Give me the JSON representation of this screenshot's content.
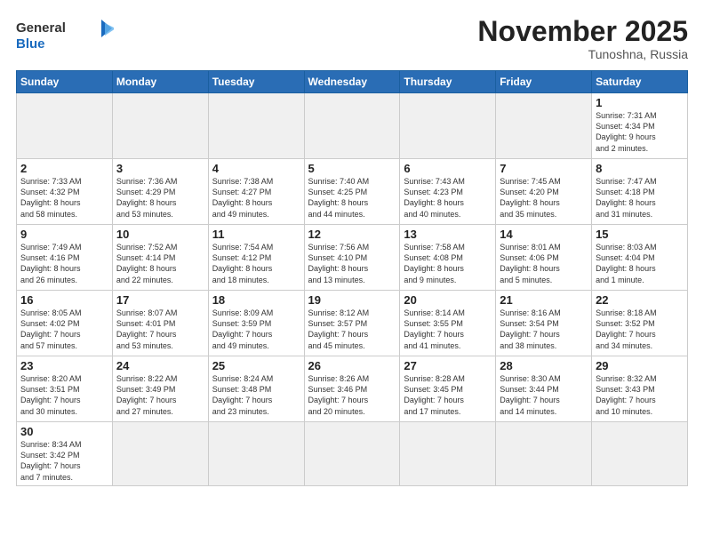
{
  "header": {
    "logo_general": "General",
    "logo_blue": "Blue",
    "month_title": "November 2025",
    "location": "Tunoshna, Russia"
  },
  "weekdays": [
    "Sunday",
    "Monday",
    "Tuesday",
    "Wednesday",
    "Thursday",
    "Friday",
    "Saturday"
  ],
  "weeks": [
    [
      {
        "day": "",
        "info": ""
      },
      {
        "day": "",
        "info": ""
      },
      {
        "day": "",
        "info": ""
      },
      {
        "day": "",
        "info": ""
      },
      {
        "day": "",
        "info": ""
      },
      {
        "day": "",
        "info": ""
      },
      {
        "day": "1",
        "info": "Sunrise: 7:31 AM\nSunset: 4:34 PM\nDaylight: 9 hours\nand 2 minutes."
      }
    ],
    [
      {
        "day": "2",
        "info": "Sunrise: 7:33 AM\nSunset: 4:32 PM\nDaylight: 8 hours\nand 58 minutes."
      },
      {
        "day": "3",
        "info": "Sunrise: 7:36 AM\nSunset: 4:29 PM\nDaylight: 8 hours\nand 53 minutes."
      },
      {
        "day": "4",
        "info": "Sunrise: 7:38 AM\nSunset: 4:27 PM\nDaylight: 8 hours\nand 49 minutes."
      },
      {
        "day": "5",
        "info": "Sunrise: 7:40 AM\nSunset: 4:25 PM\nDaylight: 8 hours\nand 44 minutes."
      },
      {
        "day": "6",
        "info": "Sunrise: 7:43 AM\nSunset: 4:23 PM\nDaylight: 8 hours\nand 40 minutes."
      },
      {
        "day": "7",
        "info": "Sunrise: 7:45 AM\nSunset: 4:20 PM\nDaylight: 8 hours\nand 35 minutes."
      },
      {
        "day": "8",
        "info": "Sunrise: 7:47 AM\nSunset: 4:18 PM\nDaylight: 8 hours\nand 31 minutes."
      }
    ],
    [
      {
        "day": "9",
        "info": "Sunrise: 7:49 AM\nSunset: 4:16 PM\nDaylight: 8 hours\nand 26 minutes."
      },
      {
        "day": "10",
        "info": "Sunrise: 7:52 AM\nSunset: 4:14 PM\nDaylight: 8 hours\nand 22 minutes."
      },
      {
        "day": "11",
        "info": "Sunrise: 7:54 AM\nSunset: 4:12 PM\nDaylight: 8 hours\nand 18 minutes."
      },
      {
        "day": "12",
        "info": "Sunrise: 7:56 AM\nSunset: 4:10 PM\nDaylight: 8 hours\nand 13 minutes."
      },
      {
        "day": "13",
        "info": "Sunrise: 7:58 AM\nSunset: 4:08 PM\nDaylight: 8 hours\nand 9 minutes."
      },
      {
        "day": "14",
        "info": "Sunrise: 8:01 AM\nSunset: 4:06 PM\nDaylight: 8 hours\nand 5 minutes."
      },
      {
        "day": "15",
        "info": "Sunrise: 8:03 AM\nSunset: 4:04 PM\nDaylight: 8 hours\nand 1 minute."
      }
    ],
    [
      {
        "day": "16",
        "info": "Sunrise: 8:05 AM\nSunset: 4:02 PM\nDaylight: 7 hours\nand 57 minutes."
      },
      {
        "day": "17",
        "info": "Sunrise: 8:07 AM\nSunset: 4:01 PM\nDaylight: 7 hours\nand 53 minutes."
      },
      {
        "day": "18",
        "info": "Sunrise: 8:09 AM\nSunset: 3:59 PM\nDaylight: 7 hours\nand 49 minutes."
      },
      {
        "day": "19",
        "info": "Sunrise: 8:12 AM\nSunset: 3:57 PM\nDaylight: 7 hours\nand 45 minutes."
      },
      {
        "day": "20",
        "info": "Sunrise: 8:14 AM\nSunset: 3:55 PM\nDaylight: 7 hours\nand 41 minutes."
      },
      {
        "day": "21",
        "info": "Sunrise: 8:16 AM\nSunset: 3:54 PM\nDaylight: 7 hours\nand 38 minutes."
      },
      {
        "day": "22",
        "info": "Sunrise: 8:18 AM\nSunset: 3:52 PM\nDaylight: 7 hours\nand 34 minutes."
      }
    ],
    [
      {
        "day": "23",
        "info": "Sunrise: 8:20 AM\nSunset: 3:51 PM\nDaylight: 7 hours\nand 30 minutes."
      },
      {
        "day": "24",
        "info": "Sunrise: 8:22 AM\nSunset: 3:49 PM\nDaylight: 7 hours\nand 27 minutes."
      },
      {
        "day": "25",
        "info": "Sunrise: 8:24 AM\nSunset: 3:48 PM\nDaylight: 7 hours\nand 23 minutes."
      },
      {
        "day": "26",
        "info": "Sunrise: 8:26 AM\nSunset: 3:46 PM\nDaylight: 7 hours\nand 20 minutes."
      },
      {
        "day": "27",
        "info": "Sunrise: 8:28 AM\nSunset: 3:45 PM\nDaylight: 7 hours\nand 17 minutes."
      },
      {
        "day": "28",
        "info": "Sunrise: 8:30 AM\nSunset: 3:44 PM\nDaylight: 7 hours\nand 14 minutes."
      },
      {
        "day": "29",
        "info": "Sunrise: 8:32 AM\nSunset: 3:43 PM\nDaylight: 7 hours\nand 10 minutes."
      }
    ],
    [
      {
        "day": "30",
        "info": "Sunrise: 8:34 AM\nSunset: 3:42 PM\nDaylight: 7 hours\nand 7 minutes."
      },
      {
        "day": "",
        "info": ""
      },
      {
        "day": "",
        "info": ""
      },
      {
        "day": "",
        "info": ""
      },
      {
        "day": "",
        "info": ""
      },
      {
        "day": "",
        "info": ""
      },
      {
        "day": "",
        "info": ""
      }
    ]
  ]
}
